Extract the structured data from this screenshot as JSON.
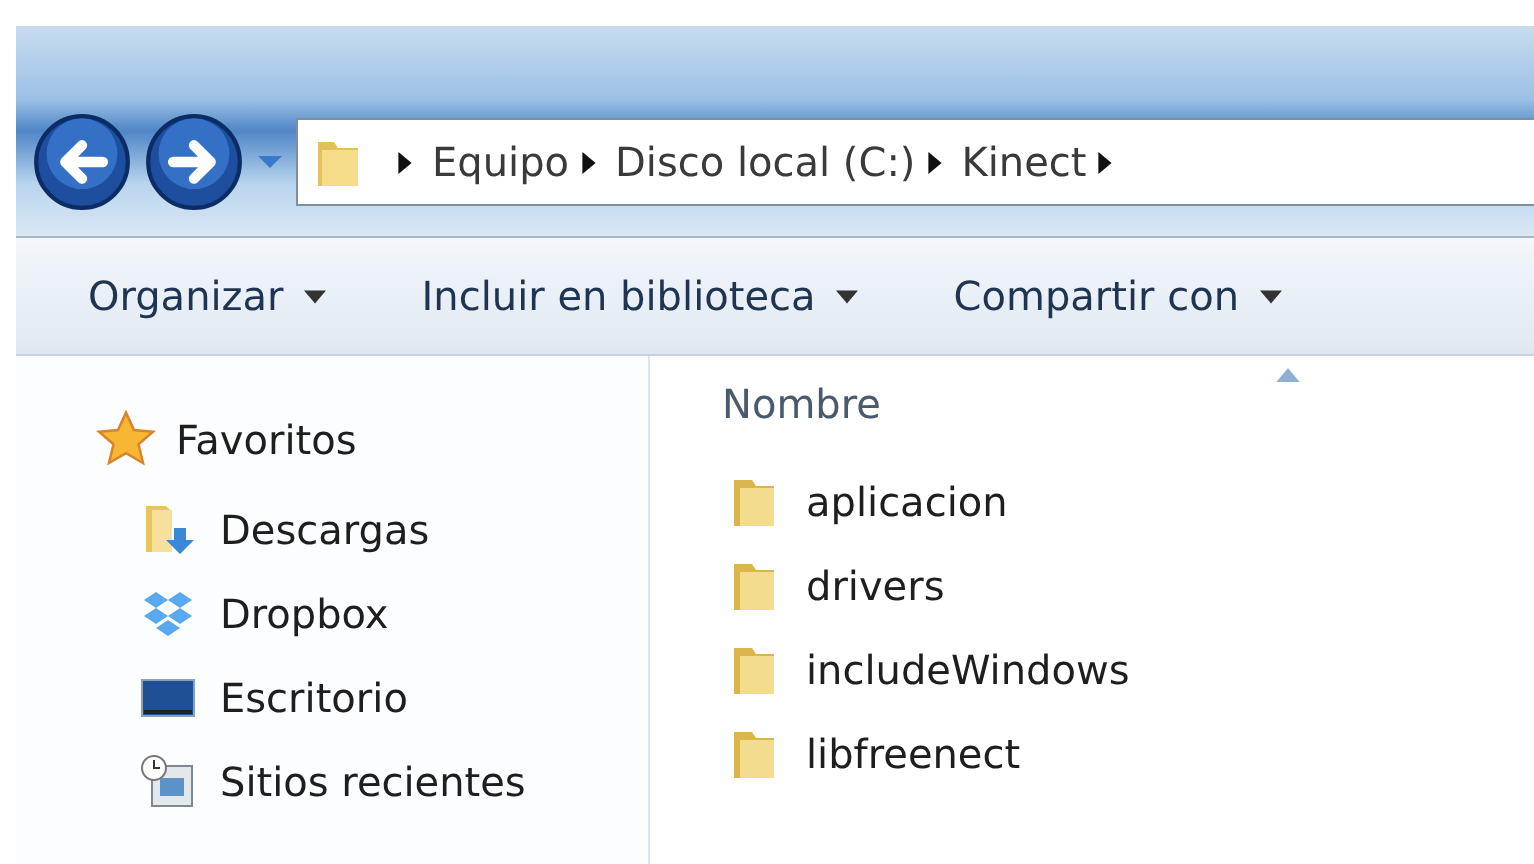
{
  "address_bar": {
    "crumbs": [
      "Equipo",
      "Disco local (C:)",
      "Kinect"
    ]
  },
  "toolbar": {
    "buttons": [
      "Organizar",
      "Incluir en biblioteca",
      "Compartir con"
    ]
  },
  "sidebar": {
    "header": {
      "label": "Favoritos",
      "kind": "star"
    },
    "items": [
      {
        "label": "Descargas",
        "kind": "downloads"
      },
      {
        "label": "Dropbox",
        "kind": "dropbox"
      },
      {
        "label": "Escritorio",
        "kind": "desktop"
      },
      {
        "label": "Sitios recientes",
        "kind": "recent"
      }
    ]
  },
  "file_list": {
    "column": {
      "label": "Nombre",
      "sorted": true
    },
    "items": [
      "aplicacion",
      "drivers",
      "includeWindows",
      "libfreenect"
    ]
  }
}
